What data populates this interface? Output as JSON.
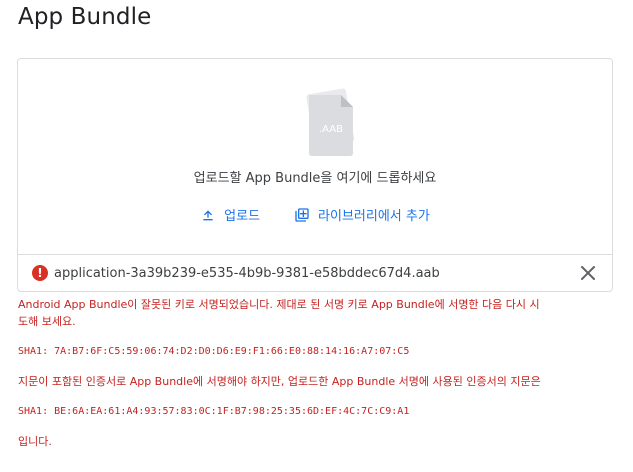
{
  "header": {
    "title": "App Bundle"
  },
  "dropzone": {
    "illustration_label": ".AAB",
    "instruction": "업로드할 App Bundle을 여기에 드롭하세요",
    "upload_label": "업로드",
    "library_label": "라이브러리에서 추가"
  },
  "file": {
    "name": "application-3a39b239-e535-4b9b-9381-e58bddec67d4.aab"
  },
  "errors": {
    "line1": "Android App Bundle이 잘못된 키로 서명되었습니다. 제대로 된 서명 키로 App Bundle에 서명한 다음 다시 시",
    "line2": "도해 보세요.",
    "sha_expected": "SHA1: 7A:B7:6F:C5:59:06:74:D2:D0:D6:E9:F1:66:E0:88:14:16:A7:07:C5",
    "line3": "지문이 포함된 인증서로 App Bundle에 서명해야 하지만, 업로드한 App Bundle 서명에 사용된 인증서의 지문은",
    "sha_actual": "SHA1: BE:6A:EA:61:A4:93:57:83:0C:1F:B7:98:25:35:6D:EF:4C:7C:C9:A1",
    "line4": "입니다."
  },
  "colors": {
    "accent": "#1a73e8",
    "error": "#d93025",
    "error_text": "#c5221f",
    "border": "#dadce0"
  },
  "icons": {
    "upload": "upload-icon",
    "library": "add-box-icon",
    "error": "error-icon",
    "close": "close-icon"
  }
}
